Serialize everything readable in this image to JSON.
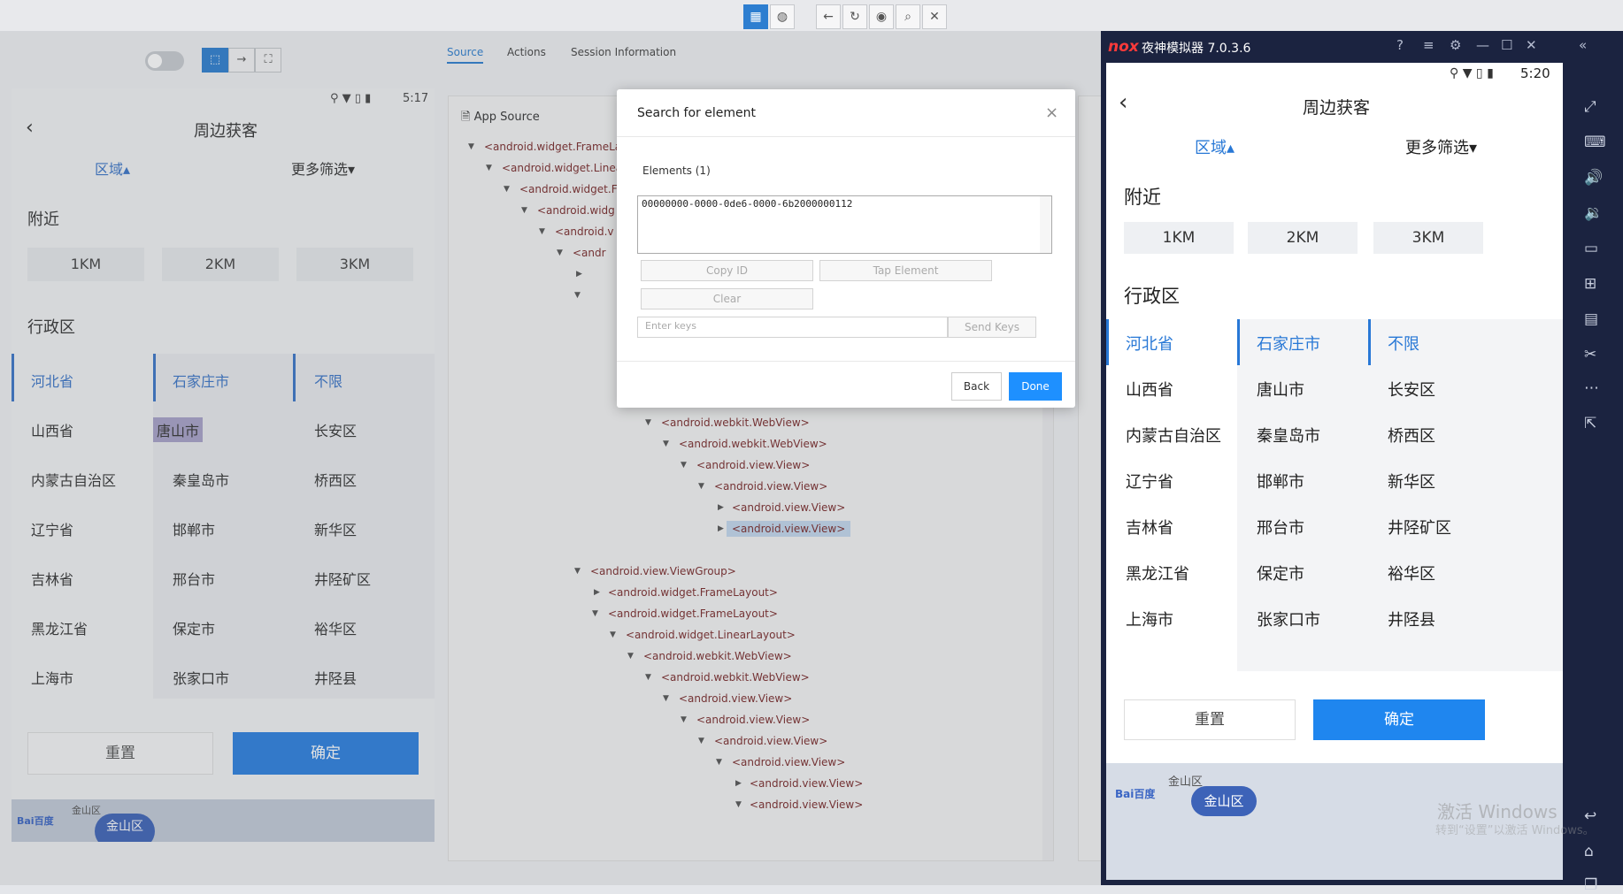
{
  "inspector": {
    "tabs": [
      "Source",
      "Actions",
      "Session Information"
    ],
    "panel_title": "App Source",
    "toolbar_icons": [
      "grid-icon",
      "globe-icon",
      "back-icon",
      "refresh-icon",
      "eye-icon",
      "search-icon",
      "close-icon"
    ],
    "tree_nodes": [
      "<android.widget.FrameLayout>",
      "<android.widget.LinearLayout>",
      "<android.widget.FrameLayout>",
      "<android.widget.FrameLayout>",
      "<android.view.ViewGroup>",
      "<android.widget.FrameLayout>",
      "<android.webkit.WebView>",
      "<android.webkit.WebView>",
      "<android.view.View>",
      "<android.view.View>",
      "<android.view.View>",
      "<android.view.View>",
      "<android.view.ViewGroup>",
      "<android.widget.FrameLayout>",
      "<android.widget.FrameLayout>",
      "<android.widget.LinearLayout>",
      "<android.webkit.WebView>",
      "<android.webkit.WebView>",
      "<android.view.View>",
      "<android.view.View>",
      "<android.view.View>",
      "<android.view.View>",
      "<android.view.View>",
      "<android.view.View>"
    ],
    "tree_truncated": [
      "<android.widget.FrameLayou",
      "<android.widget.Linear",
      "<android.widget.Fr",
      "<android.widg",
      "<android.v",
      "<andr"
    ]
  },
  "device_screenshot": {
    "time": "5:17",
    "title": "周边获客",
    "filter_region": "区域",
    "filter_more": "更多筛选",
    "nearby": "附近",
    "km": [
      "1KM",
      "2KM",
      "3KM"
    ],
    "admin": "行政区",
    "col1": [
      "河北省",
      "山西省",
      "内蒙古自治区",
      "辽宁省",
      "吉林省",
      "黑龙江省",
      "上海市"
    ],
    "col2": [
      "石家庄市",
      "唐山市",
      "秦皇岛市",
      "邯郸市",
      "邢台市",
      "保定市",
      "张家口市"
    ],
    "col3": [
      "不限",
      "长安区",
      "桥西区",
      "新华区",
      "井陉矿区",
      "裕华区",
      "井陉县"
    ],
    "reset": "重置",
    "confirm": "确定",
    "map_label": "金山区",
    "map_small": "金山区"
  },
  "modal": {
    "title": "Search for element",
    "elements_label": "Elements (1)",
    "element_id": "00000000-0000-0de6-0000-6b2000000112",
    "copy_id": "Copy ID",
    "tap_element": "Tap Element",
    "clear": "Clear",
    "enter_keys_placeholder": "Enter keys",
    "send_keys": "Send Keys",
    "back": "Back",
    "done": "Done"
  },
  "nox": {
    "logo": "nox",
    "title": "夜神模拟器 7.0.3.6",
    "phone": {
      "time": "5:20",
      "title": "周边获客",
      "filter_region": "区域",
      "filter_more": "更多筛选",
      "nearby": "附近",
      "km": [
        "1KM",
        "2KM",
        "3KM"
      ],
      "admin": "行政区",
      "col1": [
        "河北省",
        "山西省",
        "内蒙古自治区",
        "辽宁省",
        "吉林省",
        "黑龙江省",
        "上海市"
      ],
      "col2": [
        "石家庄市",
        "唐山市",
        "秦皇岛市",
        "邯郸市",
        "邢台市",
        "保定市",
        "张家口市"
      ],
      "col3": [
        "不限",
        "长安区",
        "桥西区",
        "新华区",
        "井陉矿区",
        "裕华区",
        "井陉县"
      ],
      "reset": "重置",
      "confirm": "确定",
      "map_label": "金山区",
      "map_small": "金山区"
    },
    "watermark": "激活 Windows",
    "watermark_sub": "转到“设置”以激活 Windows。"
  },
  "colors": {
    "accent": "#2d7ed0",
    "done": "#1e90ff",
    "nox_frame": "#1b2340",
    "phone_blue": "#2878d6"
  }
}
